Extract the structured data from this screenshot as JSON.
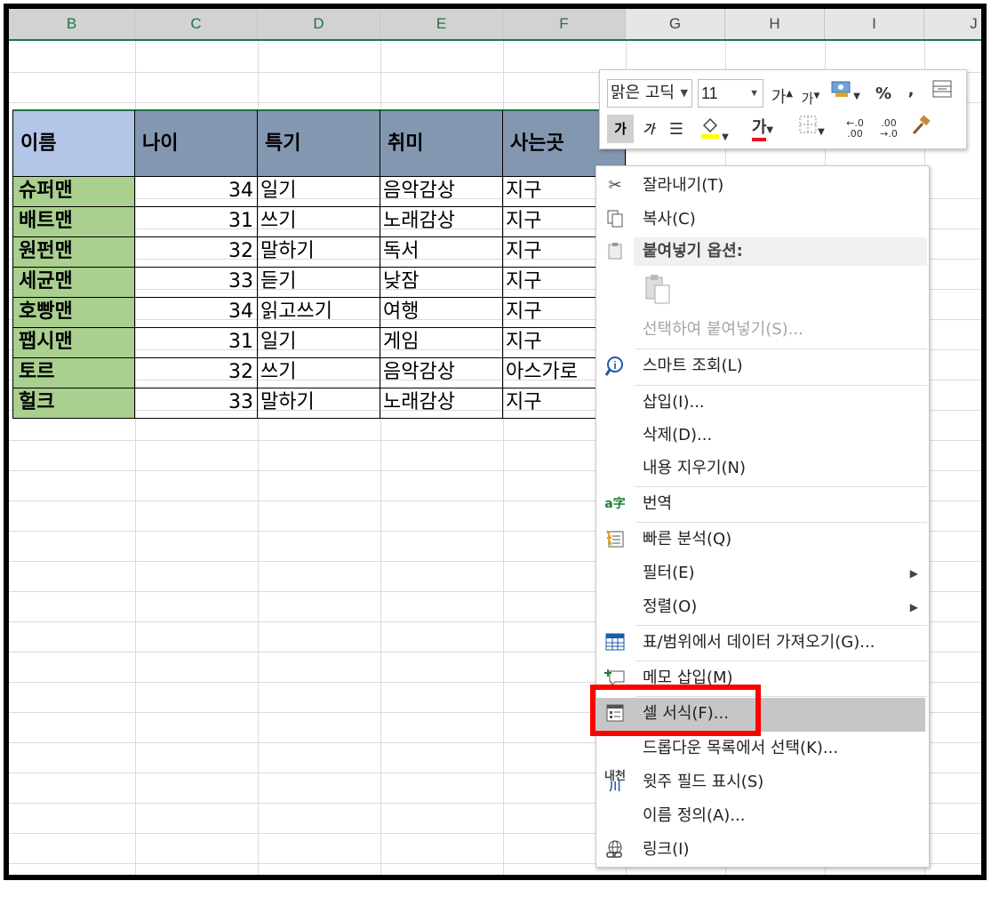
{
  "columns": [
    "B",
    "C",
    "D",
    "E",
    "F",
    "G",
    "H",
    "I",
    "J"
  ],
  "table": {
    "headers": [
      "이름",
      "나이",
      "특기",
      "취미",
      "사는곳"
    ],
    "rows": [
      [
        "슈퍼맨",
        "34",
        "일기",
        "음악감상",
        "지구"
      ],
      [
        "배트맨",
        "31",
        "쓰기",
        "노래감상",
        "지구"
      ],
      [
        "원펀맨",
        "32",
        "말하기",
        "독서",
        "지구"
      ],
      [
        "세균맨",
        "33",
        "듣기",
        "낮잠",
        "지구"
      ],
      [
        "호빵맨",
        "34",
        "읽고쓰기",
        "여행",
        "지구"
      ],
      [
        "팹시맨",
        "31",
        "일기",
        "게임",
        "지구"
      ],
      [
        "토르",
        "32",
        "쓰기",
        "음악감상",
        "아스가로"
      ],
      [
        "헐크",
        "33",
        "말하기",
        "노래감상",
        "지구"
      ]
    ]
  },
  "mini_toolbar": {
    "font_name": "맑은 고딕",
    "font_size": "11",
    "grow_font": "가",
    "shrink_font": "가",
    "percent": "%",
    "comma": ",",
    "bold": "가",
    "italic": "가",
    "font_color_glyph": "가",
    "inc_decimal": ".00",
    "dec_decimal": ".00"
  },
  "context_menu": {
    "cut": "잘라내기(T)",
    "copy": "복사(C)",
    "paste_options": "붙여넣기 옵션:",
    "paste_special": "선택하여 붙여넣기(S)...",
    "smart_lookup": "스마트 조회(L)",
    "insert": "삽입(I)...",
    "delete": "삭제(D)...",
    "clear_contents": "내용 지우기(N)",
    "translate": "번역",
    "quick_analysis": "빠른 분석(Q)",
    "filter": "필터(E)",
    "sort": "정렬(O)",
    "get_data": "표/범위에서 데이터 가져오기(G)...",
    "insert_comment": "메모 삽입(M)",
    "format_cells": "셀 서식(F)...",
    "pick_dropdown": "드롭다운 목록에서 선택(K)...",
    "phonetic": "윗주 필드 표시(S)",
    "define_name": "이름 정의(A)...",
    "link": "링크(I)",
    "submenu_arrow": "▶"
  },
  "colors": {
    "header_first": "#b4c6e7",
    "header": "#8497b0",
    "name_cells": "#a9d08e",
    "highlight_box": "#ff0000",
    "excel_green": "#217346"
  }
}
